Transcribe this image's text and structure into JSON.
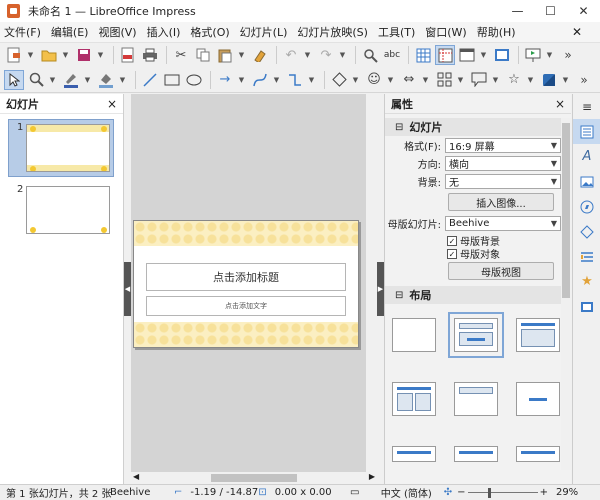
{
  "window": {
    "title": "未命名 1 — LibreOffice Impress",
    "minimize": "—",
    "maximize": "☐",
    "close": "✕"
  },
  "menu": [
    "文件(F)",
    "编辑(E)",
    "视图(V)",
    "插入(I)",
    "格式(O)",
    "幻灯片(L)",
    "幻灯片放映(S)",
    "工具(T)",
    "窗口(W)",
    "帮助(H)"
  ],
  "menu_close": "✕",
  "slides_panel": {
    "title": "幻灯片",
    "close": "×",
    "slides": [
      {
        "num": "1"
      },
      {
        "num": "2"
      }
    ]
  },
  "slide": {
    "title_placeholder": "点击添加标题",
    "subtitle_placeholder": "点击添加文字"
  },
  "sidebar": {
    "title": "属性",
    "close": "×",
    "slide_section": "幻灯片",
    "format_label": "格式(F):",
    "format_value": "16:9 屏幕",
    "orientation_label": "方向:",
    "orientation_value": "横向",
    "background_label": "背景:",
    "background_value": "无",
    "insert_image": "插入图像...",
    "master_label": "母版幻灯片:",
    "master_value": "Beehive",
    "master_background": "母版背景",
    "master_objects": "母版对象",
    "master_view": "母版视图",
    "layout_section": "布局"
  },
  "status": {
    "slide_info": "第 1 张幻灯片，共 2 张",
    "master": "Beehive",
    "position": "-1.19 / -14.87",
    "size": "0.00 x 0.00",
    "language": "中文 (简体)",
    "zoom": "29%"
  },
  "icons": {
    "toolbar1": [
      "new-icon",
      "open-icon",
      "save-icon",
      "export-pdf-icon",
      "print-icon",
      "cut-icon",
      "copy-icon",
      "paste-icon",
      "clone-icon",
      "undo-icon",
      "redo-icon",
      "find-replace-icon",
      "spelling-icon",
      "grid-icon",
      "helplines-icon",
      "display-views-icon",
      "master-slide-icon",
      "start-show-icon"
    ],
    "toolbar2": [
      "select-icon",
      "zoom-icon",
      "line-color-icon",
      "fill-color-icon",
      "line-icon",
      "rectangle-icon",
      "ellipse-icon",
      "arrow-icon",
      "curve-icon",
      "connector-icon",
      "basic-shapes-icon",
      "symbol-shapes-icon",
      "block-arrows-icon",
      "flowchart-icon",
      "callouts-icon",
      "stars-icon",
      "3d-objects-icon"
    ]
  },
  "colors": {
    "accent": "#3b7ac7",
    "honey": "#f3c832",
    "selection": "#b7cce7"
  }
}
